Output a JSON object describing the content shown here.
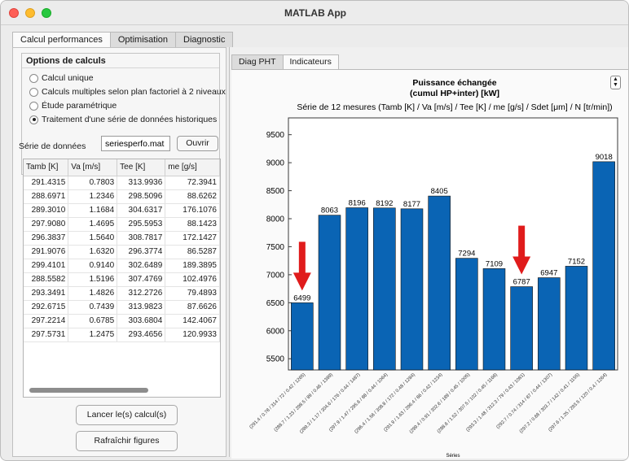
{
  "window": {
    "title": "MATLAB App"
  },
  "main_tabs": [
    {
      "label": "Calcul performances"
    },
    {
      "label": "Optimisation"
    },
    {
      "label": "Diagnostic"
    }
  ],
  "options": {
    "title": "Options de calculs",
    "radios": [
      {
        "label": "Calcul unique",
        "checked": false
      },
      {
        "label": "Calculs multiples selon plan factoriel à 2 niveaux",
        "checked": false
      },
      {
        "label": "Étude paramétrique",
        "checked": false
      },
      {
        "label": "Traitement d'une série de données historiques",
        "checked": true
      }
    ]
  },
  "series": {
    "label": "Série de données",
    "file_value": "seriesperfo.mat",
    "open_label": "Ouvrir"
  },
  "table": {
    "columns": [
      "Tamb [K]",
      "Va [m/s]",
      "Tee [K]",
      "me [g/s]"
    ],
    "rows": [
      [
        "291.4315",
        "0.7803",
        "313.9936",
        "72.3941"
      ],
      [
        "288.6971",
        "1.2346",
        "298.5096",
        "88.6262"
      ],
      [
        "289.3010",
        "1.1684",
        "304.6317",
        "176.1076"
      ],
      [
        "297.9080",
        "1.4695",
        "295.5953",
        "88.1423"
      ],
      [
        "296.3837",
        "1.5640",
        "308.7817",
        "172.1427"
      ],
      [
        "291.9076",
        "1.6320",
        "296.3774",
        "86.5287"
      ],
      [
        "299.4101",
        "0.9140",
        "302.6489",
        "189.3895"
      ],
      [
        "288.5582",
        "1.5196",
        "307.4769",
        "102.4976"
      ],
      [
        "293.3491",
        "1.4826",
        "312.2726",
        "79.4893"
      ],
      [
        "292.6715",
        "0.7439",
        "313.9823",
        "87.6626"
      ],
      [
        "297.2214",
        "0.6785",
        "303.6804",
        "142.4067"
      ],
      [
        "297.5731",
        "1.2475",
        "293.4656",
        "120.9933"
      ]
    ]
  },
  "buttons": {
    "run_label": "Lancer le(s) calcul(s)",
    "refresh_label": "Rafraîchir figures"
  },
  "sub_tabs": [
    {
      "label": "Diag PHT"
    },
    {
      "label": "Indicateurs"
    }
  ],
  "colors": {
    "bar": "#0a64b4",
    "arrow": "#e01b1b",
    "window_bg": "#ececec"
  },
  "icons": {
    "stepper": "up-down-stepper-icon",
    "arrow": "red-down-arrow-icon"
  },
  "chart_data": {
    "type": "bar",
    "title": "Puissance échangée",
    "title_line2": "(cumul HP+inter) [kW]",
    "subtitle": "Série de 12 mesures (Tamb [K] / Va [m/s] / Tee [K] / me [g/s] / Sdet [μm] / N [tr/min])",
    "xlabel": "Séries",
    "ylabel": "",
    "ylim": [
      5300,
      9800
    ],
    "yticks": [
      5500,
      6000,
      6500,
      7000,
      7500,
      8000,
      8500,
      9000,
      9500
    ],
    "grid": false,
    "categories": [
      "(291.4 / 0.78 / 314 / 72 / 0.42 / 1265)",
      "(288.7 / 1.23 / 298.5 / 89 / 0.46 / 1389)",
      "(289.3 / 1.17 / 304.6 / 176 / 0.44 / 1487)",
      "(297.9 / 1.47 / 295.6 / 88 / 0.44 / 1064)",
      "(296.4 / 1.56 / 308.8 / 172 / 0.48 / 1284)",
      "(291.9 / 1.63 / 296.4 / 86 / 0.42 / 1234)",
      "(299.4 / 0.91 / 302.6 / 189 / 0.45 / 1005)",
      "(288.6 / 1.52 / 307.5 / 102 / 0.45 / 1166)",
      "(293.3 / 1.48 / 312.3 / 79 / 0.43 / 1081)",
      "(292.7 / 0.74 / 314 / 87 / 0.44 / 1307)",
      "(297.2 / 0.68 / 303.7 / 142 / 0.41 / 1155)",
      "(297.6 / 1.25 / 293.5 / 120 / 0.4 / 1264)"
    ],
    "values": [
      6499,
      8063,
      8196,
      8192,
      8177,
      8405,
      7294,
      7109,
      6787,
      6947,
      7152,
      9018
    ],
    "highlighted_bars": [
      0,
      8
    ]
  }
}
